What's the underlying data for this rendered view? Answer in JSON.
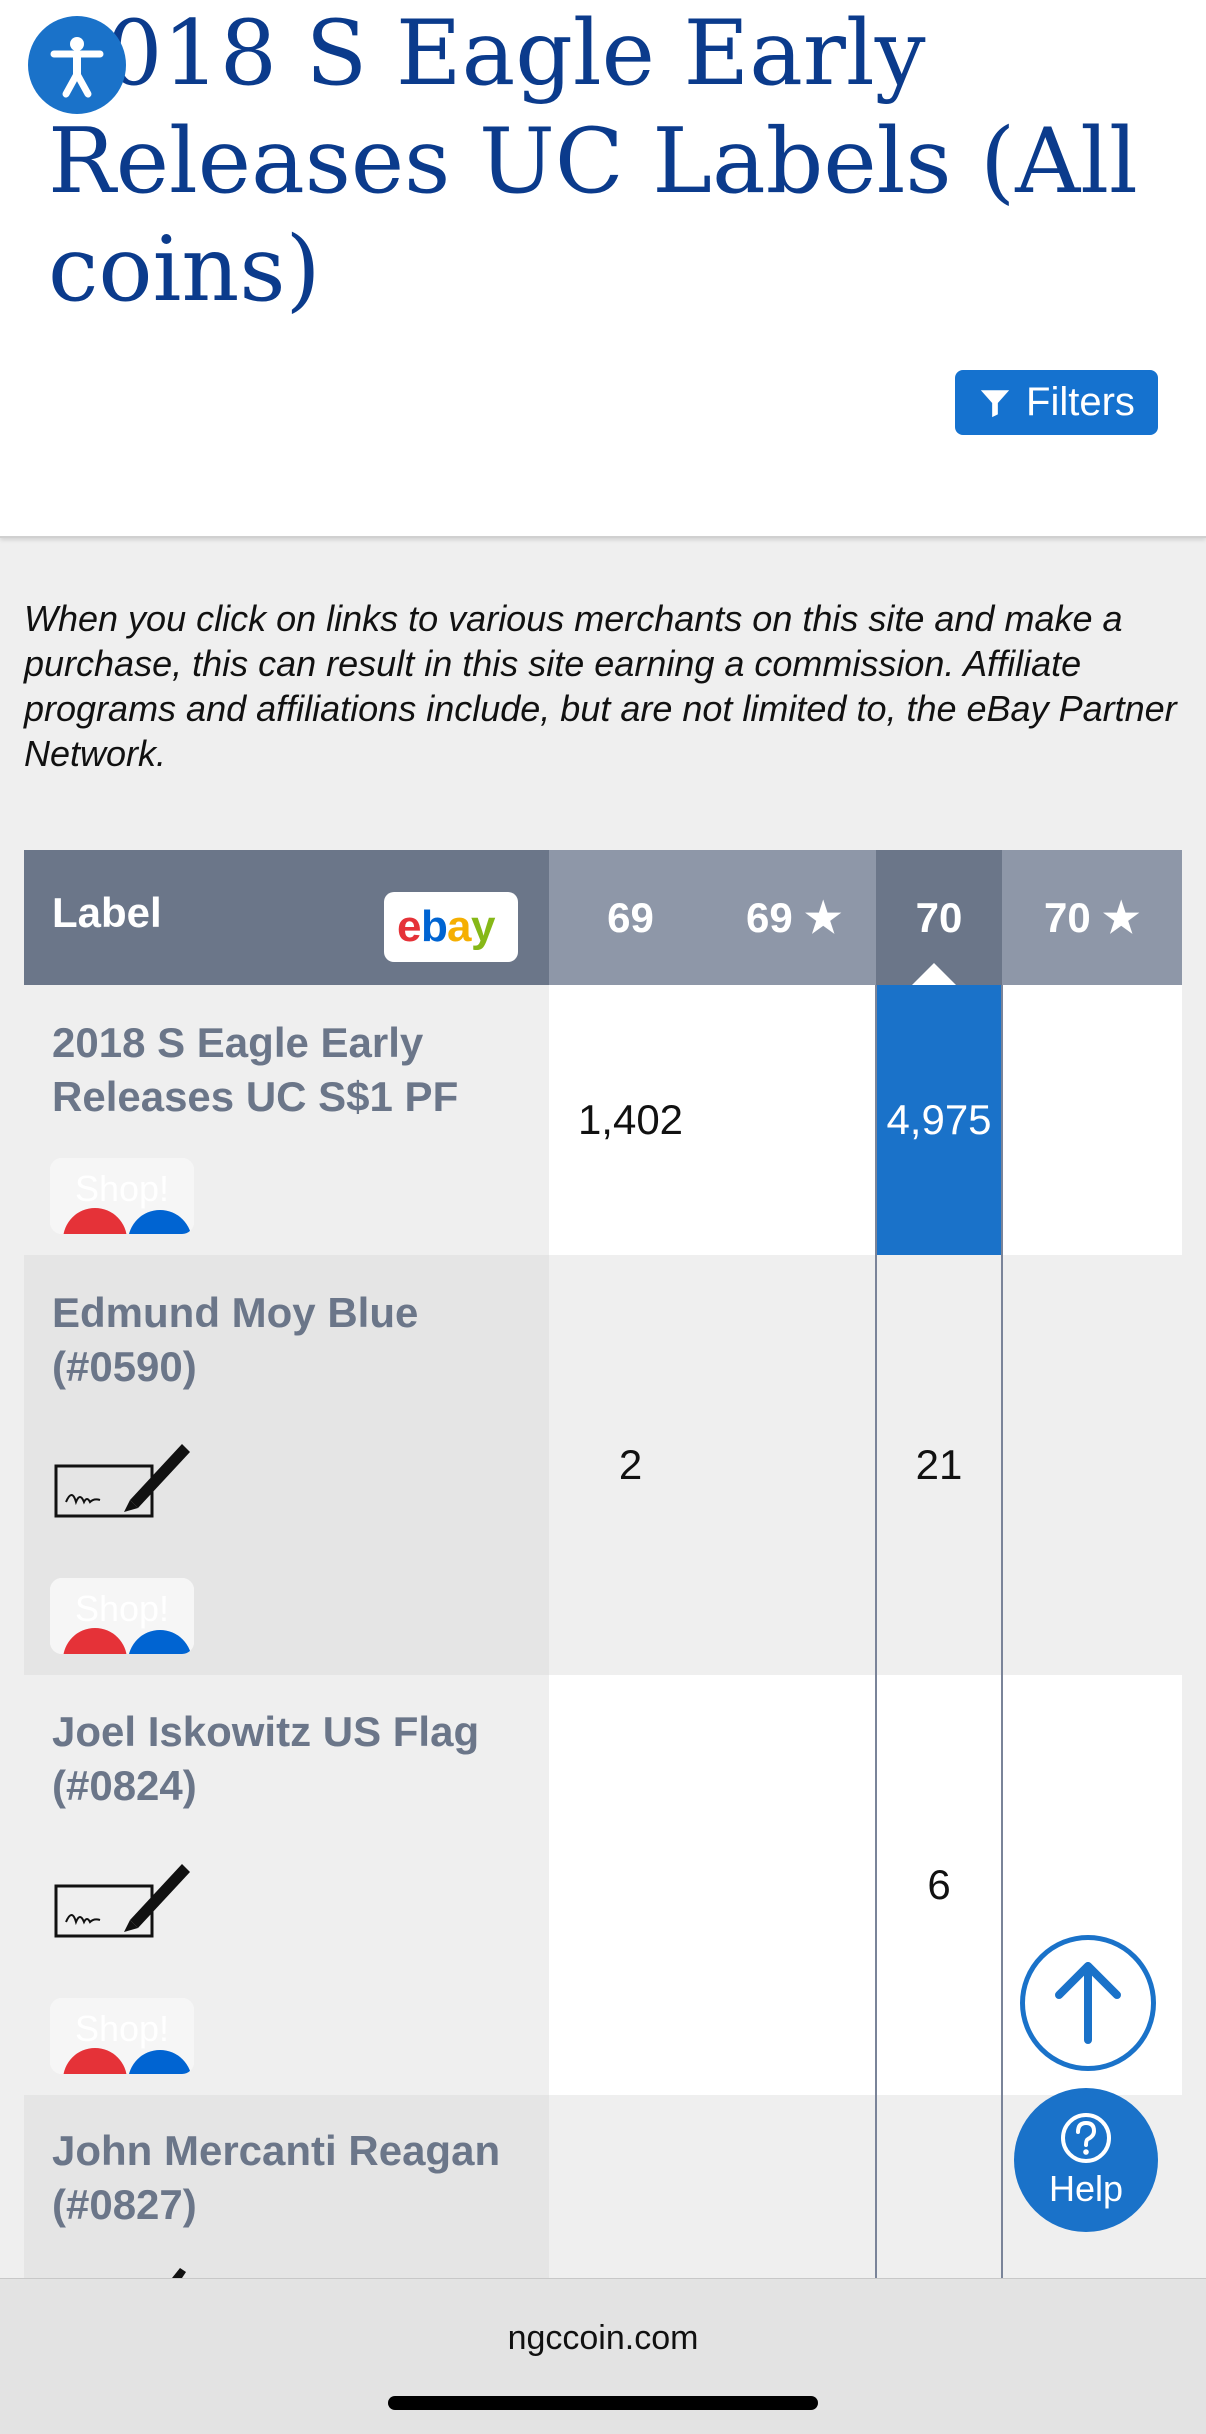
{
  "header": {
    "title": "2018 S Eagle Early Releases UC Labels (All coins)",
    "filters_label": "Filters"
  },
  "disclaimer": "When you click on links to various merchants on this site and make a purchase, this can result in this site earning a commission. Affiliate programs and affiliations include, but are not limited to, the eBay Partner Network.",
  "table": {
    "columns": {
      "label": "Label",
      "c69": "69",
      "c69s": "69 ★",
      "c70": "70",
      "c70s": "70 ★"
    },
    "rows": [
      {
        "label": "2018 S Eagle Early Releases UC S$1 PF",
        "c69": "1,402",
        "c69s": "",
        "c70": "4,975",
        "c70s": "",
        "shop": "Shop!"
      },
      {
        "label": "Edmund Moy Blue (#0590)",
        "c69": "2",
        "c69s": "",
        "c70": "21",
        "c70s": "",
        "shop": "Shop!"
      },
      {
        "label": "Joel Iskowitz US Flag (#0824)",
        "c69": "",
        "c69s": "",
        "c70": "6",
        "c70s": "",
        "shop": "Shop!"
      },
      {
        "label": "John Mercanti Reagan (#0827)",
        "c69": "",
        "c69s": "",
        "c70": "",
        "c70s": ""
      }
    ]
  },
  "ebay_logo_text": "ebay",
  "help_label": "Help",
  "browser": {
    "url": "ngccoin.com"
  },
  "colors": {
    "title": "#0b3b8c",
    "accent": "#1a72c9",
    "header_dark": "#6b7689",
    "header_light": "#8e97a8"
  },
  "icons": [
    "accessibility-icon",
    "filter-icon",
    "signature-icon",
    "arrow-up-icon",
    "question-icon"
  ]
}
